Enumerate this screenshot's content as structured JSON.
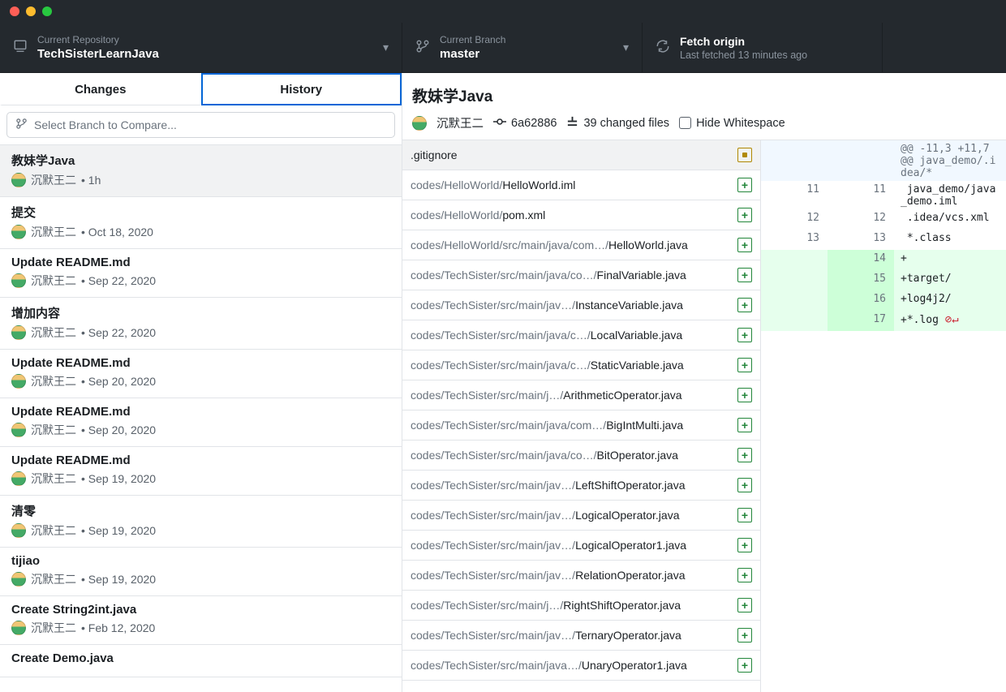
{
  "toolbar": {
    "repo_label": "Current Repository",
    "repo_value": "TechSisterLearnJava",
    "branch_label": "Current Branch",
    "branch_value": "master",
    "fetch_label": "Fetch origin",
    "fetch_sub": "Last fetched 13 minutes ago"
  },
  "tabs": {
    "changes": "Changes",
    "history": "History"
  },
  "branch_filter_placeholder": "Select Branch to Compare...",
  "commits": [
    {
      "title": "教妹学Java",
      "author": "沉默王二",
      "date": "1h",
      "selected": true
    },
    {
      "title": "提交",
      "author": "沉默王二",
      "date": "Oct 18, 2020"
    },
    {
      "title": "Update README.md",
      "author": "沉默王二",
      "date": "Sep 22, 2020"
    },
    {
      "title": "增加内容",
      "author": "沉默王二",
      "date": "Sep 22, 2020"
    },
    {
      "title": "Update README.md",
      "author": "沉默王二",
      "date": "Sep 20, 2020"
    },
    {
      "title": "Update README.md",
      "author": "沉默王二",
      "date": "Sep 20, 2020"
    },
    {
      "title": "Update README.md",
      "author": "沉默王二",
      "date": "Sep 19, 2020"
    },
    {
      "title": "清零",
      "author": "沉默王二",
      "date": "Sep 19, 2020"
    },
    {
      "title": "tijiao",
      "author": "沉默王二",
      "date": "Sep 19, 2020"
    },
    {
      "title": "Create String2int.java",
      "author": "沉默王二",
      "date": "Feb 12, 2020"
    },
    {
      "title": "Create Demo.java",
      "author": "",
      "date": ""
    }
  ],
  "commit_detail": {
    "title": "教妹学Java",
    "author": "沉默王二",
    "sha": "6a62886",
    "changed_files": "39 changed files",
    "hide_ws": "Hide Whitespace"
  },
  "files": [
    {
      "path": "",
      "name": ".gitignore",
      "status": "modified",
      "selected": true
    },
    {
      "path": "codes/HelloWorld/",
      "name": "HelloWorld.iml",
      "status": "added"
    },
    {
      "path": "codes/HelloWorld/",
      "name": "pom.xml",
      "status": "added"
    },
    {
      "path": "codes/HelloWorld/src/main/java/com…/",
      "name": "HelloWorld.java",
      "status": "added"
    },
    {
      "path": "codes/TechSister/src/main/java/co…/",
      "name": "FinalVariable.java",
      "status": "added"
    },
    {
      "path": "codes/TechSister/src/main/jav…/",
      "name": "InstanceVariable.java",
      "status": "added"
    },
    {
      "path": "codes/TechSister/src/main/java/c…/",
      "name": "LocalVariable.java",
      "status": "added"
    },
    {
      "path": "codes/TechSister/src/main/java/c…/",
      "name": "StaticVariable.java",
      "status": "added"
    },
    {
      "path": "codes/TechSister/src/main/j…/",
      "name": "ArithmeticOperator.java",
      "status": "added"
    },
    {
      "path": "codes/TechSister/src/main/java/com…/",
      "name": "BigIntMulti.java",
      "status": "added"
    },
    {
      "path": "codes/TechSister/src/main/java/co…/",
      "name": "BitOperator.java",
      "status": "added"
    },
    {
      "path": "codes/TechSister/src/main/jav…/",
      "name": "LeftShiftOperator.java",
      "status": "added"
    },
    {
      "path": "codes/TechSister/src/main/jav…/",
      "name": "LogicalOperator.java",
      "status": "added"
    },
    {
      "path": "codes/TechSister/src/main/jav…/",
      "name": "LogicalOperator1.java",
      "status": "added"
    },
    {
      "path": "codes/TechSister/src/main/jav…/",
      "name": "RelationOperator.java",
      "status": "added"
    },
    {
      "path": "codes/TechSister/src/main/j…/",
      "name": "RightShiftOperator.java",
      "status": "added"
    },
    {
      "path": "codes/TechSister/src/main/jav…/",
      "name": "TernaryOperator.java",
      "status": "added"
    },
    {
      "path": "codes/TechSister/src/main/java…/",
      "name": "UnaryOperator1.java",
      "status": "added"
    }
  ],
  "diff": {
    "hunk": "@@ -11,3 +11,7 @@ java_demo/.idea/*",
    "lines": [
      {
        "ol": "11",
        "nl": "11",
        "type": "ctx",
        "text": " java_demo/java_demo.iml"
      },
      {
        "ol": "12",
        "nl": "12",
        "type": "ctx",
        "text": " .idea/vcs.xml"
      },
      {
        "ol": "13",
        "nl": "13",
        "type": "ctx",
        "text": " *.class"
      },
      {
        "ol": "",
        "nl": "14",
        "type": "add",
        "text": "+"
      },
      {
        "ol": "",
        "nl": "15",
        "type": "add",
        "text": "+target/"
      },
      {
        "ol": "",
        "nl": "16",
        "type": "add",
        "text": "+log4j2/"
      },
      {
        "ol": "",
        "nl": "17",
        "type": "add",
        "text": "+*.log",
        "noeol": true
      }
    ]
  }
}
